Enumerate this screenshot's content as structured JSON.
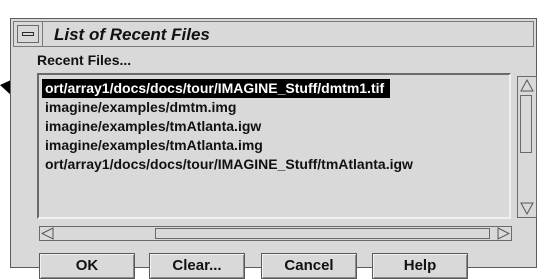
{
  "window": {
    "title": "List of Recent Files",
    "menu_icon": "window-menu-icon"
  },
  "recent_label": "Recent Files...",
  "files": [
    "ort/array1/docs/docs/tour/IMAGINE_Stuff/dmtm1.tif",
    "imagine/examples/dmtm.img",
    "imagine/examples/tmAtlanta.igw",
    "imagine/examples/tmAtlanta.img",
    "ort/array1/docs/docs/tour/IMAGINE_Stuff/tmAtlanta.igw"
  ],
  "selected_index": 0,
  "buttons": {
    "ok": "OK",
    "clear": "Clear...",
    "cancel": "Cancel",
    "help": "Help"
  },
  "colors": {
    "background": "#d9d9d9",
    "selection": "#000000",
    "selection_text": "#ffffff"
  }
}
